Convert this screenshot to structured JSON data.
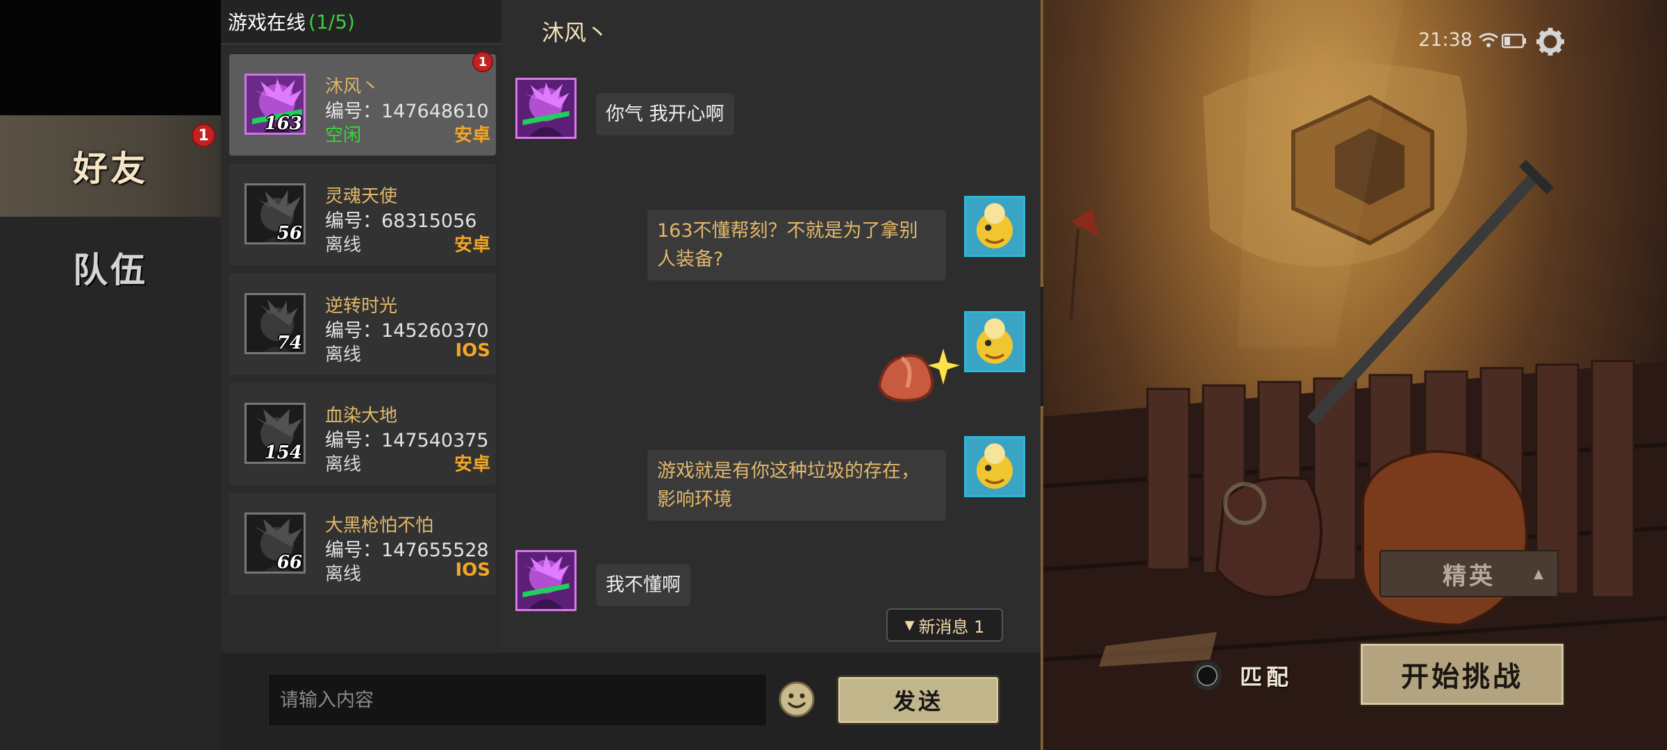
{
  "colors": {
    "accent_gold": "#e2b86a",
    "online_green": "#3ecf3e",
    "platform_orange": "#f5a623",
    "badge_red": "#c42222",
    "send_button": "#c1b58c"
  },
  "tabs": {
    "friends": {
      "label": "好友",
      "badge": "1"
    },
    "team": {
      "label": "队伍"
    }
  },
  "friend_list": {
    "header_title": "游戏在线",
    "header_count": "(1/5)",
    "id_prefix": "编号：",
    "friends": [
      {
        "name": "沐风丶",
        "id": "147648610",
        "status": "空闲",
        "platform": "安卓",
        "level": "163",
        "badge": "1",
        "avatar_icon": "purple-hero-avatar-icon"
      },
      {
        "name": "灵魂天使",
        "id": "68315056",
        "status": "离线",
        "platform": "安卓",
        "level": "56",
        "avatar_icon": "grey-hero-avatar-icon"
      },
      {
        "name": "逆转时光",
        "id": "145260370",
        "status": "离线",
        "platform": "IOS",
        "level": "74",
        "avatar_icon": "grey-hero-avatar-icon"
      },
      {
        "name": "血染大地",
        "id": "147540375",
        "status": "离线",
        "platform": "安卓",
        "level": "154",
        "avatar_icon": "grey-hero-avatar-icon"
      },
      {
        "name": "大黑枪怕不怕",
        "id": "147655528",
        "status": "离线",
        "platform": "IOS",
        "level": "66",
        "avatar_icon": "grey-hero-avatar-icon"
      }
    ]
  },
  "chat": {
    "title": "沐风丶",
    "messages": [
      {
        "from": "friend",
        "text": "你气  我开心啊"
      },
      {
        "from": "self",
        "text": "163不懂帮刻？不就是为了拿别人装备?"
      },
      {
        "from": "self",
        "sticker": "meat-sparkle-sticker"
      },
      {
        "from": "self",
        "text": "游戏就是有你这种垃圾的存在，影响环境"
      },
      {
        "from": "friend",
        "text": "我不懂啊"
      }
    ],
    "new_message_label": "新消息 1",
    "input_placeholder": "请输入内容",
    "send_label": "发送"
  },
  "status_bar": {
    "time": "21:38"
  },
  "scene": {
    "difficulty_label": "精英",
    "match_label": "匹配",
    "start_label": "开始挑战"
  }
}
